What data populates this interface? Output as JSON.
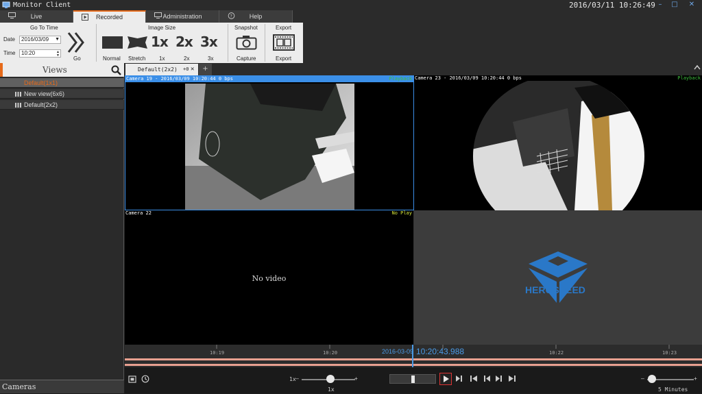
{
  "window": {
    "title": "Monitor Client",
    "clock": "2016/03/11 10:26:49",
    "controls": [
      "–",
      "□",
      "✕"
    ]
  },
  "main_tabs": [
    {
      "label": "Live",
      "icon": "monitor-icon"
    },
    {
      "label": "Recorded",
      "icon": "play-icon"
    },
    {
      "label": "Administration",
      "icon": "display-icon"
    },
    {
      "label": "Help",
      "icon": "question-icon"
    }
  ],
  "toolbar": {
    "go_to_time": {
      "title": "Go To Time",
      "date_label": "Date",
      "date_value": "2016/03/09",
      "time_label": "Time",
      "time_value": "10:20",
      "go_label": "Go"
    },
    "image_size": {
      "title": "Image Size",
      "options": [
        "Normal",
        "Stretch",
        "1x",
        "2x",
        "3x"
      ],
      "glyphs": [
        "1x",
        "2x",
        "3x"
      ]
    },
    "snapshot": {
      "title": "Snapshot",
      "label": "Capture"
    },
    "export": {
      "title": "Export",
      "label": "Export"
    }
  },
  "sidebar": {
    "views_title": "Views",
    "items": [
      {
        "label": "Default(1x1)",
        "selected": true
      },
      {
        "label": "New view(6x6)",
        "selected": false
      },
      {
        "label": "Default(2x2)",
        "selected": false
      }
    ],
    "cameras_title": "Cameras"
  },
  "view_tabs": {
    "active": "Default(2x2)",
    "count": "+0",
    "close": "✕",
    "add": "+"
  },
  "panes": [
    {
      "label": "Camera 19 - 2016/03/09 10:20:44 0 bps",
      "status": "Playback",
      "status_color": "#3fbf3f"
    },
    {
      "label": "Camera 23 - 2016/03/09 10:20:44 0 bps",
      "status": "Playback",
      "status_color": "#3fbf3f"
    },
    {
      "label": "Camera 22",
      "status": "No Play",
      "status_color": "#d8e83c",
      "message": "No video"
    },
    {
      "label": "",
      "status": "",
      "brand": "HEROSPEED"
    }
  ],
  "timeline": {
    "ticks": [
      "10:19",
      "10:20",
      "10:21",
      "10:22",
      "10:23"
    ],
    "current_date": "2016-03-09",
    "current_time": "10:20:43.988"
  },
  "controls": {
    "speed_min_label": "1x",
    "speed_value_label": "1x",
    "zoom_label": "5 Minutes",
    "minus": "–",
    "plus": "+"
  },
  "colors": {
    "accent": "#e66a1a",
    "selection": "#3b8fe8",
    "brand_blue": "#2a78c8"
  }
}
